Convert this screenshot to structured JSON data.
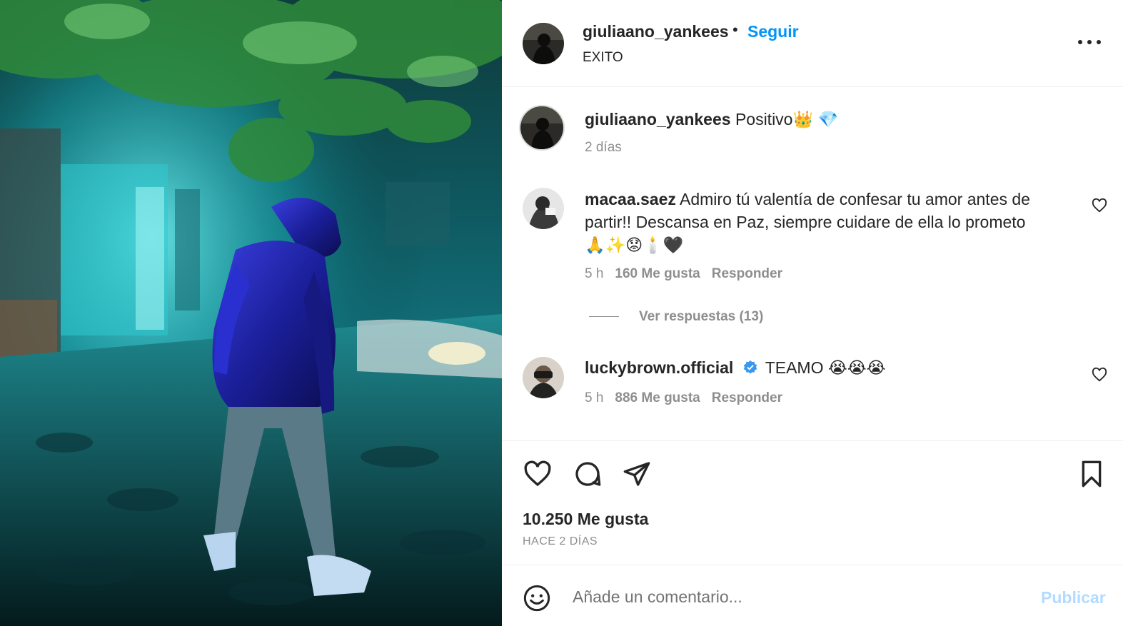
{
  "post": {
    "username": "giuliaano_yankees",
    "separator": "•",
    "follow_label": "Seguir",
    "location": "EXITO",
    "more_icon": "more-options-icon"
  },
  "caption": {
    "username": "giuliaano_yankees",
    "text": "Positivo👑 💎",
    "time": "2 días"
  },
  "comments": [
    {
      "username": "macaa.saez",
      "line1": "Admiro tú valentía de confesar tu amor antes de",
      "line2": "partir!! Descansa en Paz, siempre cuidare de ella lo prometo",
      "line3": "🙏✨😟🕯️🖤",
      "time": "5 h",
      "likes": "160 Me gusta",
      "reply_label": "Responder",
      "view_replies": "Ver respuestas (13)"
    },
    {
      "username": "luckybrown.official",
      "text": "TEAMO 😭😭😭",
      "time": "5 h",
      "likes": "886 Me gusta",
      "reply_label": "Responder"
    }
  ],
  "actions": {
    "likes_count": "10.250 Me gusta",
    "posted": "HACE 2 DÍAS"
  },
  "composer": {
    "placeholder": "Añade un comentario...",
    "publish_label": "Publicar"
  },
  "colors": {
    "link_blue": "#0095f6",
    "publish_disabled": "#b3dbff",
    "text_secondary": "#8e8e8e",
    "verified_blue": "#3897f0"
  }
}
